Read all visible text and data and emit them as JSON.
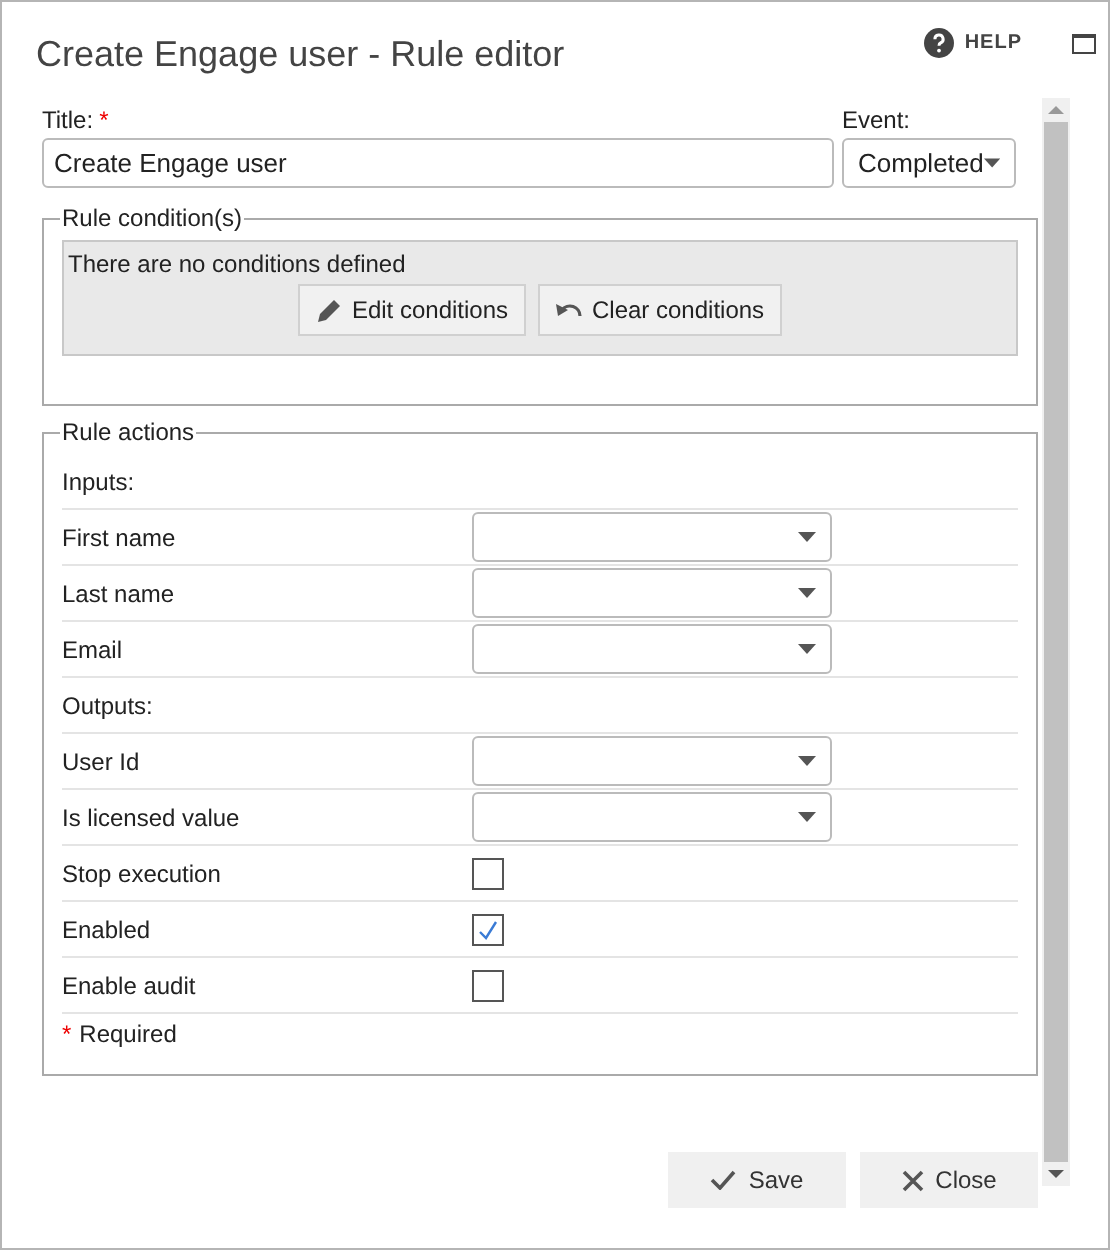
{
  "window": {
    "title": "Create Engage user - Rule editor",
    "help": "HELP"
  },
  "title_field": {
    "label": "Title:",
    "required_mark": "*",
    "value": "Create Engage user"
  },
  "event_field": {
    "label": "Event:",
    "value": "Completed"
  },
  "conditions": {
    "legend": "Rule condition(s)",
    "message": "There are no conditions defined",
    "buttons": [
      {
        "label": "Edit conditions",
        "kind": "edit"
      },
      {
        "label": "Clear conditions",
        "kind": "clear"
      }
    ]
  },
  "actions": {
    "legend": "Rule actions",
    "rows": [
      {
        "kind": "section",
        "label": "Inputs:"
      },
      {
        "kind": "select",
        "label": "First name"
      },
      {
        "kind": "select",
        "label": "Last name"
      },
      {
        "kind": "select",
        "label": "Email"
      },
      {
        "kind": "section",
        "label": "Outputs:"
      },
      {
        "kind": "select",
        "label": "User Id"
      },
      {
        "kind": "select",
        "label": "Is licensed value"
      },
      {
        "kind": "checkbox",
        "label": "Stop execution",
        "checked": false
      },
      {
        "kind": "checkbox",
        "label": "Enabled",
        "checked": true
      },
      {
        "kind": "checkbox",
        "label": "Enable audit",
        "checked": false
      }
    ],
    "required_note": {
      "mark": "*",
      "text": "Required"
    }
  },
  "footer_buttons": [
    {
      "label": "Save",
      "kind": "save"
    },
    {
      "label": "Close",
      "kind": "close"
    }
  ]
}
